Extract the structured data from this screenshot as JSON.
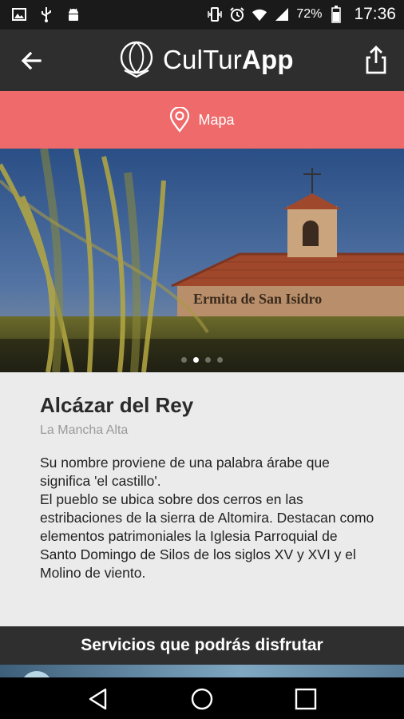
{
  "status_bar": {
    "battery": "72%",
    "time": "17:36",
    "left_icons": [
      "image-icon",
      "usb-icon",
      "android-icon"
    ],
    "right_icons": [
      "vibrate-icon",
      "alarm-icon",
      "wifi-icon",
      "signal-icon",
      "battery-icon"
    ]
  },
  "app_bar": {
    "brand_regular": "CulTur",
    "brand_bold": "App",
    "back_icon": "arrow-back-icon",
    "share_icon": "share-icon"
  },
  "map_bar": {
    "label": "Mapa",
    "icon": "location-pin-icon",
    "color": "#ee6a6b"
  },
  "hero": {
    "sign_text": "Ermita de San Isidro",
    "slides": 4,
    "active_slide": 2
  },
  "place": {
    "title": "Alcázar del Rey",
    "region": "La Mancha Alta",
    "description_1": "Su nombre proviene de una palabra árabe que significa 'el castillo'.",
    "description_2": "El pueblo se ubica sobre dos cerros en las estribaciones de la sierra de Altomira. Destacan como elementos patrimoniales la Iglesia Parroquial de Santo Domingo de Silos de los siglos XV y XVI y el Molino de viento."
  },
  "services": {
    "heading": "Servicios que podrás disfrutar"
  },
  "nav": {
    "buttons": [
      "back-triangle-icon",
      "home-circle-icon",
      "recents-square-icon"
    ]
  }
}
